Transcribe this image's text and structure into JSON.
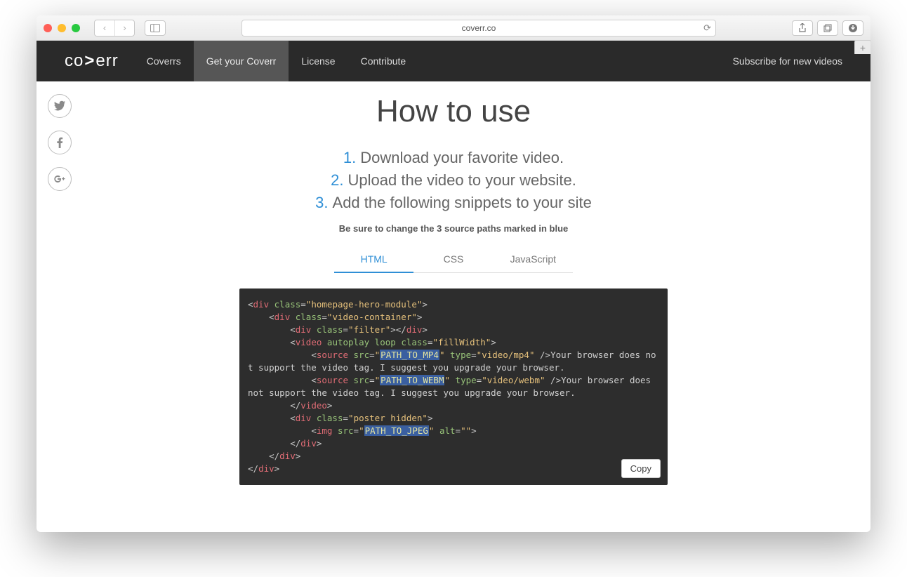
{
  "browser": {
    "url": "coverr.co"
  },
  "nav": {
    "logo_pre": "co",
    "logo_mid": ">",
    "logo_post": "err",
    "links": [
      {
        "label": "Coverrs",
        "active": false
      },
      {
        "label": "Get your Coverr",
        "active": true
      },
      {
        "label": "License",
        "active": false
      },
      {
        "label": "Contribute",
        "active": false
      }
    ],
    "subscribe": "Subscribe for new videos"
  },
  "page": {
    "title": "How to use",
    "steps": [
      "Download your favorite video.",
      "Upload the video to your website.",
      "Add the following snippets to your site"
    ],
    "note": "Be sure to change the 3 source paths marked in blue",
    "tabs": [
      {
        "label": "HTML",
        "active": true
      },
      {
        "label": "CSS",
        "active": false
      },
      {
        "label": "JavaScript",
        "active": false
      }
    ],
    "copy_label": "Copy",
    "code": {
      "hero_class": "homepage-hero-module",
      "container_class": "video-container",
      "filter_class": "filter",
      "fill_class": "fillWidth",
      "mp4_path": "PATH_TO_MP4",
      "mp4_type": "video/mp4",
      "webm_path": "PATH_TO_WEBM",
      "webm_type": "video/webm",
      "jpeg_path": "PATH_TO_JPEG",
      "poster_class": "poster hidden",
      "fallback": "Your browser does not support the video tag. I suggest you upgrade your browser."
    }
  }
}
